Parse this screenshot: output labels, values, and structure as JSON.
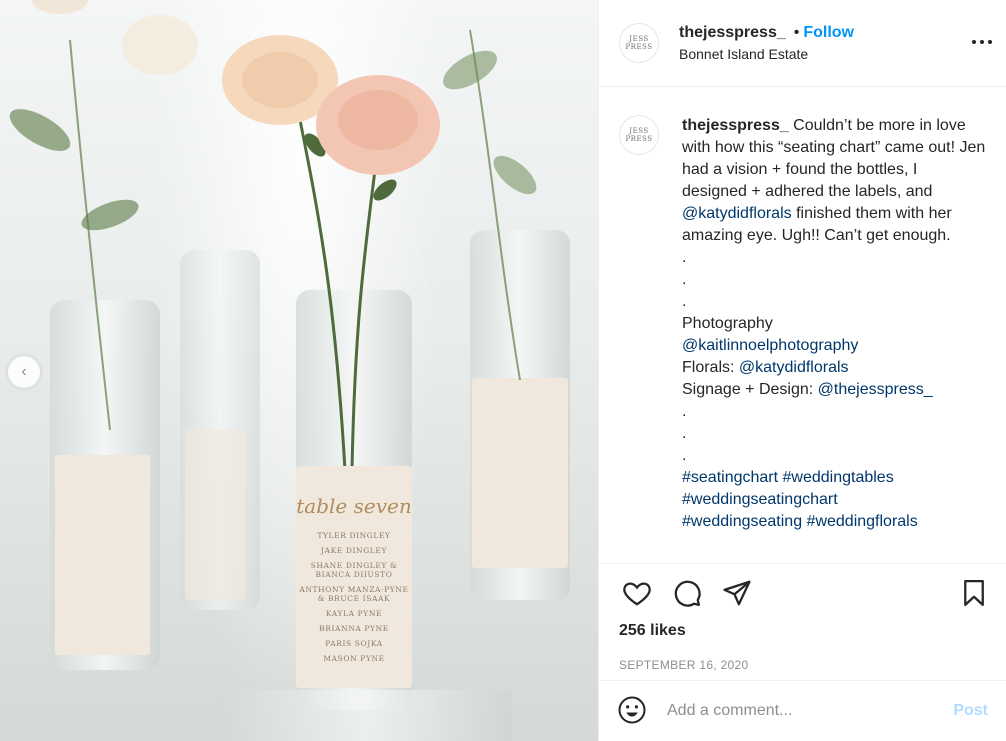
{
  "post": {
    "username": "thejesspress_",
    "follow_label": "Follow",
    "bullet": "•",
    "location": "Bonnet Island Estate",
    "more_label": "•••",
    "avatar_text": "JESS\nPRESS"
  },
  "photo": {
    "label_title": "table seven",
    "label_names": [
      "TYLER DINGLEY",
      "JAKE DINGLEY",
      "SHANE DINGLEY & BIANCA DIIUSTO",
      "ANTHONY MANZA-PYNE & BRUCE ISAAK",
      "KAYLA PYNE",
      "BRIANNA PYNE",
      "PARIS SOJKA",
      "MASON PYNE"
    ],
    "prev_glyph": "‹"
  },
  "caption": {
    "username": "thejesspress_",
    "part1": " Couldn’t be more in love with how this “seating chart” came out! Jen had a vision + found the bottles, I designed + adhered the labels, and ",
    "mention1": "@katydidflorals",
    "part2": " finished them with her amazing eye. Ugh!! Can’t get enough.\n.\n.\n.\nPhotography\n",
    "mention2": "@kaitlinnoelphotography",
    "part3": "\nFlorals: ",
    "mention3": "@katydidflorals",
    "part4": "\nSignage + Design: ",
    "mention4": "@thejesspress_",
    "part5": "\n.\n.\n.\n",
    "hashtags1": "#seatingchart #weddingtables",
    "hashtags2": "#weddingseatingchart",
    "hashtags3": "#weddingseating #weddingflorals"
  },
  "stats": {
    "likes": "256 likes",
    "date": "SEPTEMBER 16, 2020"
  },
  "comment_box": {
    "placeholder": "Add a comment...",
    "post_label": "Post"
  },
  "colors": {
    "accent": "#0095f6",
    "link": "#00376b",
    "muted": "#8e8e8e",
    "post_disabled": "#b3dbff"
  }
}
